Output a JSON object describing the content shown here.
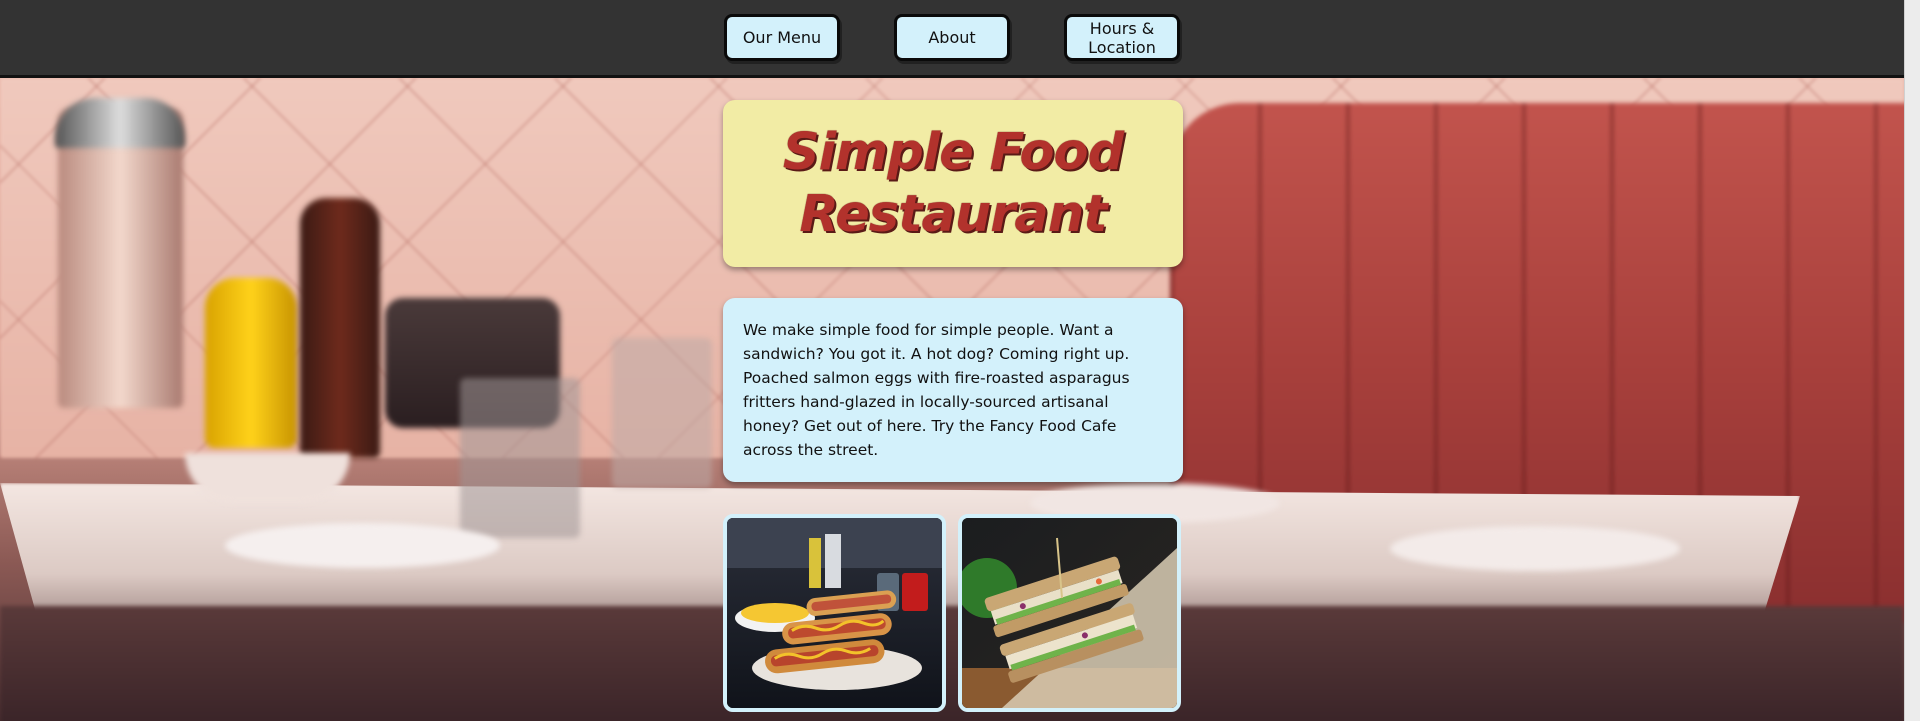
{
  "nav": {
    "items": [
      {
        "label": "Our Menu"
      },
      {
        "label": "About"
      },
      {
        "label": "Hours & Location"
      }
    ]
  },
  "hero": {
    "title": "Simple Food Restaurant",
    "description": "We make simple food for simple people. Want a sandwich? You got it. A hot dog? Coming right up. Poached salmon eggs with fire-roasted asparagus fritters hand-glazed in locally-sourced artisanal honey? Get out of here. Try the Fancy Food Cafe across the street."
  },
  "colors": {
    "nav_background": "#333333",
    "button_background": "#d3f1fb",
    "title_card": "#f2eca5",
    "title_text": "#b2322c",
    "description_card": "#d3f1fb"
  },
  "images": [
    {
      "name": "hot-dogs-photo"
    },
    {
      "name": "sandwich-photo"
    }
  ]
}
